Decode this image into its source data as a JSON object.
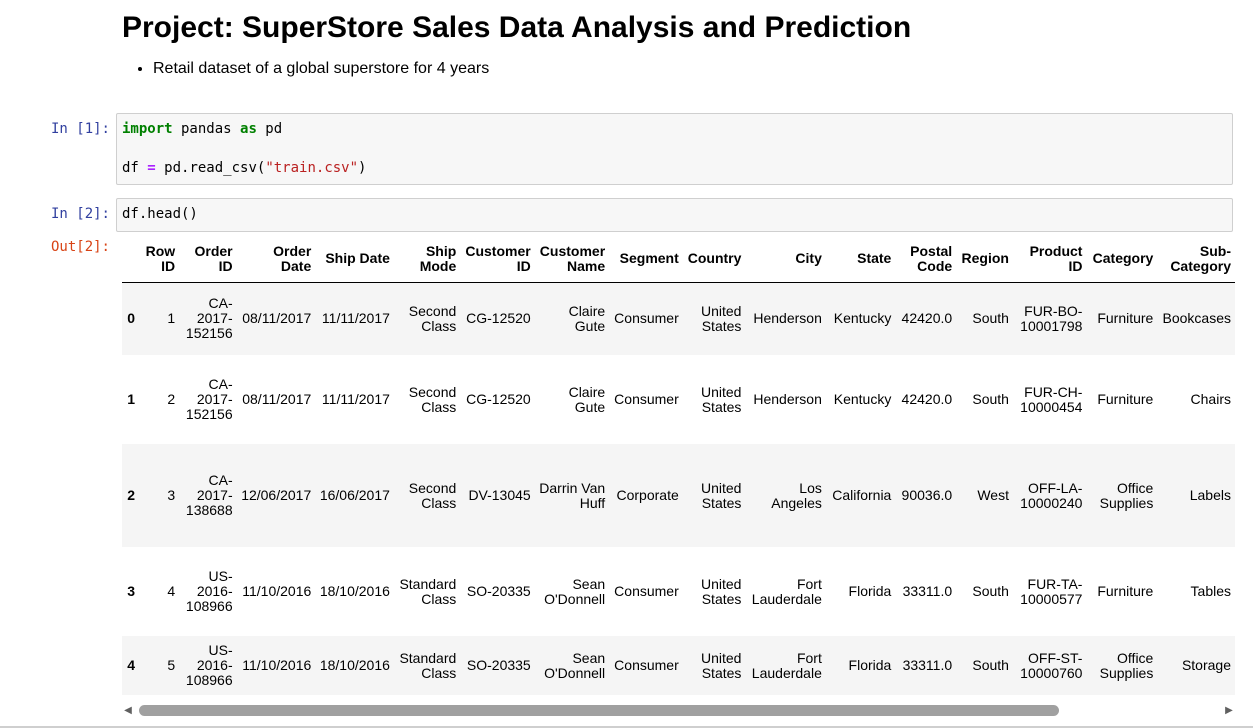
{
  "notebook": {
    "title": "Project: SuperStore Sales Data Analysis and Prediction",
    "bullet": "Retail dataset of a global superstore for 4 years"
  },
  "cells": {
    "in1_prompt": "In [1]:",
    "in1_line1": {
      "kw1": "import",
      "a": " pandas ",
      "kw2": "as",
      "b": " pd"
    },
    "in1_line2": {
      "a": "df ",
      "op": "=",
      "b": " pd.read_csv(",
      "str": "\"train.csv\"",
      "c": ")"
    },
    "in2_prompt": "In [2]:",
    "in2_code": "df.head()",
    "out2_prompt": "Out[2]:"
  },
  "table": {
    "columns": [
      "",
      "Row ID",
      "Order ID",
      "Order Date",
      "Ship Date",
      "Ship Mode",
      "Customer ID",
      "Customer Name",
      "Segment",
      "Country",
      "City",
      "State",
      "Postal Code",
      "Region",
      "Product ID",
      "Category",
      "Sub-Category"
    ],
    "rows": [
      [
        "0",
        "1",
        "CA-2017-152156",
        "08/11/2017",
        "11/11/2017",
        "Second Class",
        "CG-12520",
        "Claire Gute",
        "Consumer",
        "United States",
        "Henderson",
        "Kentucky",
        "42420.0",
        "South",
        "FUR-BO-10001798",
        "Furniture",
        "Bookcases"
      ],
      [
        "1",
        "2",
        "CA-2017-152156",
        "08/11/2017",
        "11/11/2017",
        "Second Class",
        "CG-12520",
        "Claire Gute",
        "Consumer",
        "United States",
        "Henderson",
        "Kentucky",
        "42420.0",
        "South",
        "FUR-CH-10000454",
        "Furniture",
        "Chairs"
      ],
      [
        "2",
        "3",
        "CA-2017-138688",
        "12/06/2017",
        "16/06/2017",
        "Second Class",
        "DV-13045",
        "Darrin Van Huff",
        "Corporate",
        "United States",
        "Los Angeles",
        "California",
        "90036.0",
        "West",
        "OFF-LA-10000240",
        "Office Supplies",
        "Labels"
      ],
      [
        "3",
        "4",
        "US-2016-108966",
        "11/10/2016",
        "18/10/2016",
        "Standard Class",
        "SO-20335",
        "Sean O'Donnell",
        "Consumer",
        "United States",
        "Fort Lauderdale",
        "Florida",
        "33311.0",
        "South",
        "FUR-TA-10000577",
        "Furniture",
        "Tables"
      ],
      [
        "4",
        "5",
        "US-2016-108966",
        "11/10/2016",
        "18/10/2016",
        "Standard Class",
        "SO-20335",
        "Sean O'Donnell",
        "Consumer",
        "United States",
        "Fort Lauderdale",
        "Florida",
        "33311.0",
        "South",
        "OFF-ST-10000760",
        "Office Supplies",
        "Storage"
      ]
    ]
  },
  "scrollbar": {
    "left_arrow": "◀",
    "right_arrow": "▶"
  }
}
